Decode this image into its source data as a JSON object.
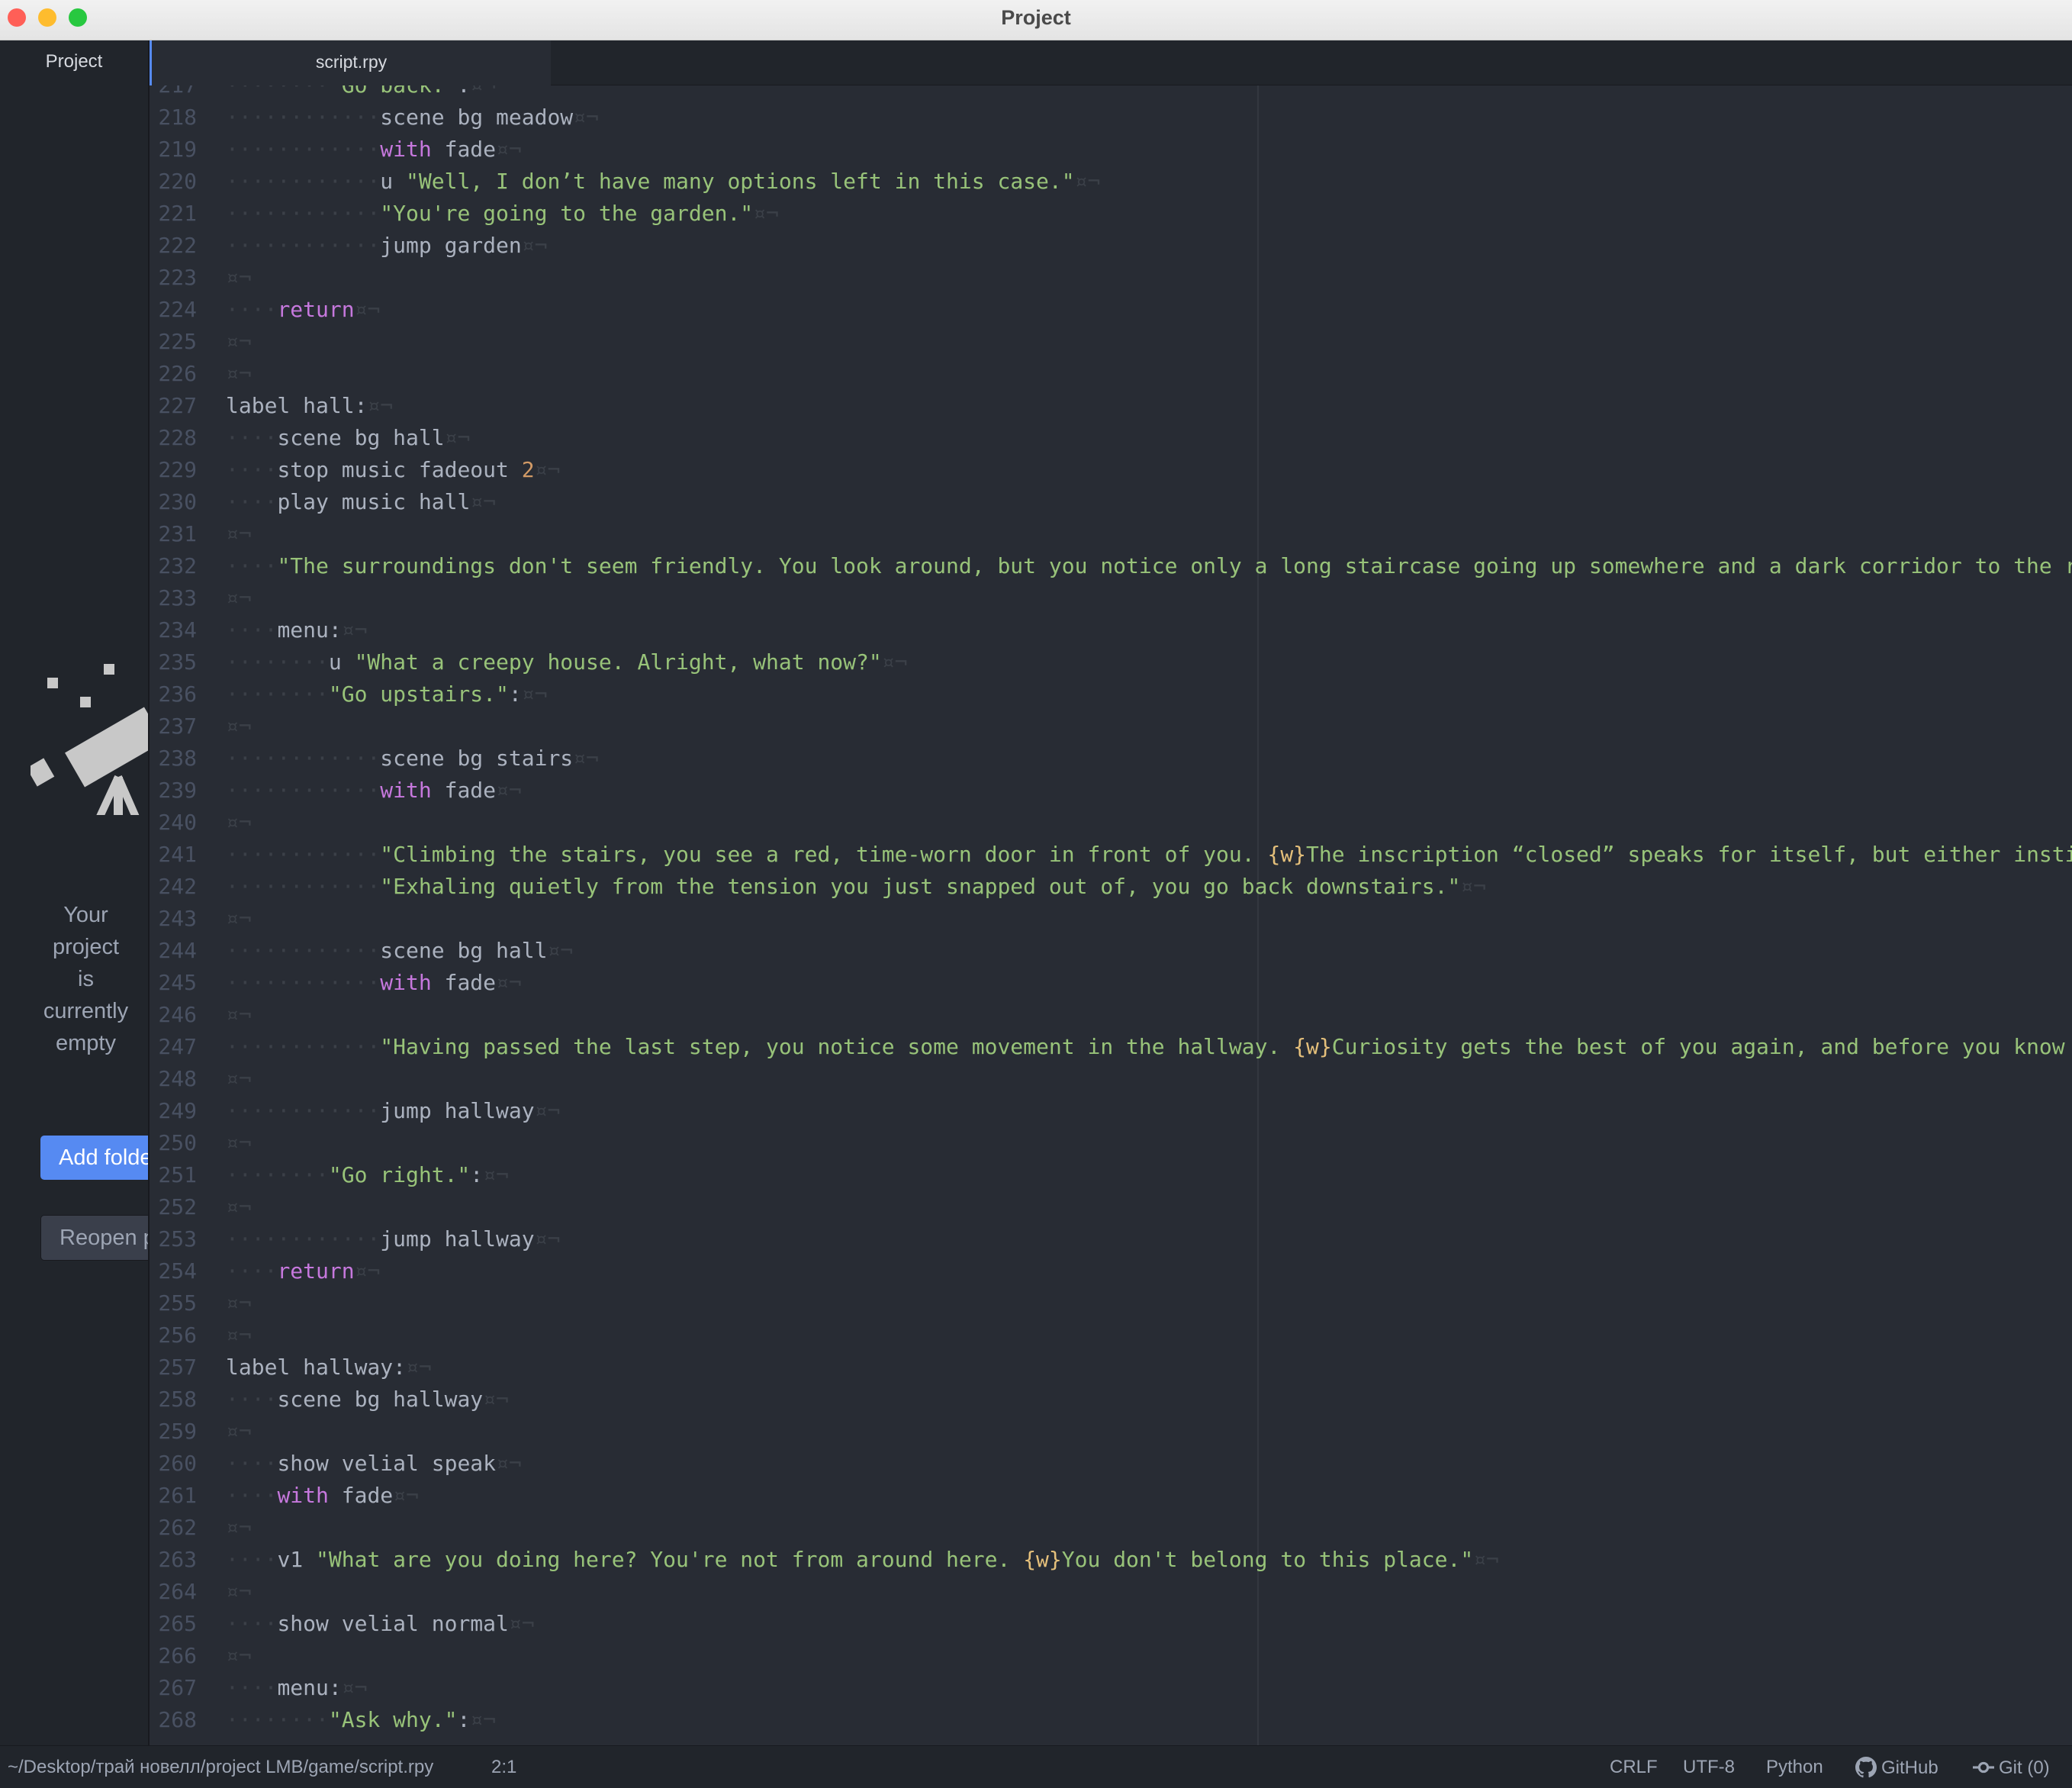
{
  "window": {
    "title": "Project",
    "traffic_lights": {
      "close": "#ff5f57",
      "minimize": "#febc2e",
      "zoom": "#28c840"
    }
  },
  "sidebar": {
    "tab_label": "Project",
    "empty_message_lines": [
      "Your",
      "project",
      "is",
      "currently",
      "empty"
    ],
    "add_folders_label": "Add folders",
    "reopen_label": "Reopen project"
  },
  "tabs": [
    {
      "label": "script.rpy",
      "active": true
    }
  ],
  "editor": {
    "lines": [
      {
        "n": "217",
        "indent": 8,
        "tokens": [
          [
            "str",
            "\"Go back.\""
          ],
          [
            "plain",
            ":"
          ]
        ]
      },
      {
        "n": "218",
        "indent": 12,
        "tokens": [
          [
            "plain",
            "scene bg meadow"
          ]
        ]
      },
      {
        "n": "219",
        "indent": 12,
        "tokens": [
          [
            "kw",
            "with"
          ],
          [
            "plain",
            " fade"
          ]
        ]
      },
      {
        "n": "220",
        "indent": 12,
        "tokens": [
          [
            "plain",
            "u "
          ],
          [
            "str",
            "\"Well, I don’t have many options left in this case.\""
          ]
        ]
      },
      {
        "n": "221",
        "indent": 12,
        "tokens": [
          [
            "str",
            "\"You're going to the garden.\""
          ]
        ]
      },
      {
        "n": "222",
        "indent": 12,
        "tokens": [
          [
            "plain",
            "jump garden"
          ]
        ]
      },
      {
        "n": "223",
        "indent": 0,
        "tokens": []
      },
      {
        "n": "224",
        "indent": 4,
        "tokens": [
          [
            "kw",
            "return"
          ]
        ]
      },
      {
        "n": "225",
        "indent": 0,
        "tokens": []
      },
      {
        "n": "226",
        "indent": 0,
        "tokens": []
      },
      {
        "n": "227",
        "indent": 0,
        "tokens": [
          [
            "plain",
            "label hall:"
          ]
        ]
      },
      {
        "n": "228",
        "indent": 4,
        "tokens": [
          [
            "plain",
            "scene bg hall"
          ]
        ]
      },
      {
        "n": "229",
        "indent": 4,
        "tokens": [
          [
            "plain",
            "stop music fadeout "
          ],
          [
            "num",
            "2"
          ]
        ]
      },
      {
        "n": "230",
        "indent": 4,
        "tokens": [
          [
            "plain",
            "play music hall"
          ]
        ]
      },
      {
        "n": "231",
        "indent": 0,
        "tokens": []
      },
      {
        "n": "232",
        "indent": 4,
        "tokens": [
          [
            "str",
            "\"The surroundings don't seem friendly. You look around, but you notice only a long staircase going up somewhere and a dark corridor to the right."
          ]
        ]
      },
      {
        "n": "233",
        "indent": 0,
        "tokens": []
      },
      {
        "n": "234",
        "indent": 4,
        "tokens": [
          [
            "plain",
            "menu:"
          ]
        ]
      },
      {
        "n": "235",
        "indent": 8,
        "tokens": [
          [
            "plain",
            "u "
          ],
          [
            "str",
            "\"What a creepy house. Alright, what now?\""
          ]
        ]
      },
      {
        "n": "236",
        "indent": 8,
        "tokens": [
          [
            "str",
            "\"Go upstairs.\""
          ],
          [
            "plain",
            ":"
          ]
        ]
      },
      {
        "n": "237",
        "indent": 0,
        "tokens": []
      },
      {
        "n": "238",
        "indent": 12,
        "tokens": [
          [
            "plain",
            "scene bg stairs"
          ]
        ]
      },
      {
        "n": "239",
        "indent": 12,
        "tokens": [
          [
            "kw",
            "with"
          ],
          [
            "plain",
            " fade"
          ]
        ]
      },
      {
        "n": "240",
        "indent": 0,
        "tokens": []
      },
      {
        "n": "241",
        "indent": 12,
        "tokens": [
          [
            "str",
            "\"Climbing the stairs, you see a red, time-worn door in front of you. "
          ],
          [
            "tag",
            "{w}"
          ],
          [
            "str",
            "The inscription “closed” speaks for itself, but either instinct"
          ]
        ]
      },
      {
        "n": "242",
        "indent": 12,
        "tokens": [
          [
            "str",
            "\"Exhaling quietly from the tension you just snapped out of, you go back downstairs.\""
          ]
        ]
      },
      {
        "n": "243",
        "indent": 0,
        "tokens": []
      },
      {
        "n": "244",
        "indent": 12,
        "tokens": [
          [
            "plain",
            "scene bg hall"
          ]
        ]
      },
      {
        "n": "245",
        "indent": 12,
        "tokens": [
          [
            "kw",
            "with"
          ],
          [
            "plain",
            " fade"
          ]
        ]
      },
      {
        "n": "246",
        "indent": 0,
        "tokens": []
      },
      {
        "n": "247",
        "indent": 12,
        "tokens": [
          [
            "str",
            "\"Having passed the last step, you notice some movement in the hallway. "
          ],
          [
            "tag",
            "{w}"
          ],
          [
            "str",
            "Curiosity gets the best of you again, and before you know it"
          ]
        ]
      },
      {
        "n": "248",
        "indent": 0,
        "tokens": []
      },
      {
        "n": "249",
        "indent": 12,
        "tokens": [
          [
            "plain",
            "jump hallway"
          ]
        ]
      },
      {
        "n": "250",
        "indent": 0,
        "tokens": []
      },
      {
        "n": "251",
        "indent": 8,
        "tokens": [
          [
            "str",
            "\"Go right.\""
          ],
          [
            "plain",
            ":"
          ]
        ]
      },
      {
        "n": "252",
        "indent": 0,
        "tokens": []
      },
      {
        "n": "253",
        "indent": 12,
        "tokens": [
          [
            "plain",
            "jump hallway"
          ]
        ]
      },
      {
        "n": "254",
        "indent": 4,
        "tokens": [
          [
            "kw",
            "return"
          ]
        ]
      },
      {
        "n": "255",
        "indent": 0,
        "tokens": []
      },
      {
        "n": "256",
        "indent": 0,
        "tokens": []
      },
      {
        "n": "257",
        "indent": 0,
        "tokens": [
          [
            "plain",
            "label hallway:"
          ]
        ]
      },
      {
        "n": "258",
        "indent": 4,
        "tokens": [
          [
            "plain",
            "scene bg hallway"
          ]
        ]
      },
      {
        "n": "259",
        "indent": 0,
        "tokens": []
      },
      {
        "n": "260",
        "indent": 4,
        "tokens": [
          [
            "plain",
            "show velial speak"
          ]
        ]
      },
      {
        "n": "261",
        "indent": 4,
        "tokens": [
          [
            "kw",
            "with"
          ],
          [
            "plain",
            " fade"
          ]
        ]
      },
      {
        "n": "262",
        "indent": 0,
        "tokens": []
      },
      {
        "n": "263",
        "indent": 4,
        "tokens": [
          [
            "plain",
            "v1 "
          ],
          [
            "str",
            "\"What are you doing here? You're not from around here. "
          ],
          [
            "tag",
            "{w}"
          ],
          [
            "str",
            "You don't belong to this place.\""
          ]
        ]
      },
      {
        "n": "264",
        "indent": 0,
        "tokens": []
      },
      {
        "n": "265",
        "indent": 4,
        "tokens": [
          [
            "plain",
            "show velial normal"
          ]
        ]
      },
      {
        "n": "266",
        "indent": 0,
        "tokens": []
      },
      {
        "n": "267",
        "indent": 4,
        "tokens": [
          [
            "plain",
            "menu:"
          ]
        ]
      },
      {
        "n": "268",
        "indent": 8,
        "tokens": [
          [
            "str",
            "\"Ask why.\""
          ],
          [
            "plain",
            ":"
          ]
        ]
      }
    ]
  },
  "statusbar": {
    "path": "~/Desktop/трай новелл/project LMB/game/script.rpy",
    "cursor": "2:1",
    "line_ending": "CRLF",
    "encoding": "UTF-8",
    "grammar": "Python",
    "github_label": "GitHub",
    "git_label": "Git (0)"
  },
  "icons": [
    "close-light-icon",
    "minimize-light-icon",
    "zoom-light-icon",
    "telescope-icon",
    "github-icon",
    "git-commit-icon"
  ]
}
